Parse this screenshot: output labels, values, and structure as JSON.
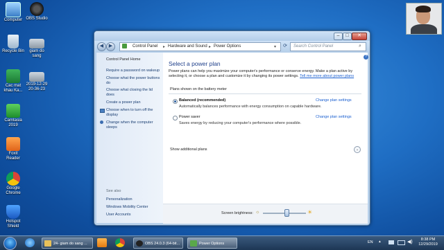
{
  "desktop": {
    "icons": [
      {
        "label": "Computer"
      },
      {
        "label": "OBS Studio"
      },
      {
        "label": "Recycle Bin"
      },
      {
        "label": "giam do sang"
      },
      {
        "label": "Cac mat khau Ka..."
      },
      {
        "label": "2019-12-29 20-36-23"
      },
      {
        "label": "Camtasia 2019"
      },
      {
        "label": "Foxit Reader"
      },
      {
        "label": "Google Chrome"
      },
      {
        "label": "Hotspot Shield"
      }
    ]
  },
  "window": {
    "address": {
      "segments": [
        "Control Panel",
        "Hardware and Sound",
        "Power Options"
      ],
      "search_placeholder": "Search Control Panel"
    },
    "sidebar": {
      "home": "Control Panel Home",
      "tasks": [
        "Require a password on wakeup",
        "Choose what the power buttons do",
        "Choose what closing the lid does",
        "Create a power plan",
        "Choose when to turn off the display",
        "Change when the computer sleeps"
      ],
      "see_also_title": "See also",
      "see_also": [
        "Personalization",
        "Windows Mobility Center",
        "User Accounts"
      ]
    },
    "main": {
      "title": "Select a power plan",
      "description": "Power plans can help you maximize your computer's performance or conserve energy. Make a plan active by selecting it, or choose a plan and customize it by changing its power settings.",
      "more_link": "Tell me more about power plans",
      "plans_caption": "Plans shown on the battery meter",
      "plans": [
        {
          "name": "Balanced (recommended)",
          "desc": "Automatically balances performance with energy consumption on capable hardware.",
          "selected": true,
          "change": "Change plan settings"
        },
        {
          "name": "Power saver",
          "desc": "Saves energy by reducing your computer's performance where possible.",
          "selected": false,
          "change": "Change plan settings"
        }
      ],
      "show_additional": "Show additional plans",
      "brightness_label": "Screen brightness:",
      "brightness_level": 0.55
    }
  },
  "taskbar": {
    "buttons": [
      {
        "label": "24- giam do sang ..."
      },
      {
        "label": "OBS 24.0.3 (64-bit..."
      },
      {
        "label": "Power Options"
      }
    ],
    "tray": {
      "language": "EN",
      "time": "8:38 PM",
      "date": "12/29/2019"
    }
  },
  "colors": {
    "accent": "#1a5fd0",
    "title_blue": "#1e3f8a",
    "desktop": "#1f6ec4"
  }
}
